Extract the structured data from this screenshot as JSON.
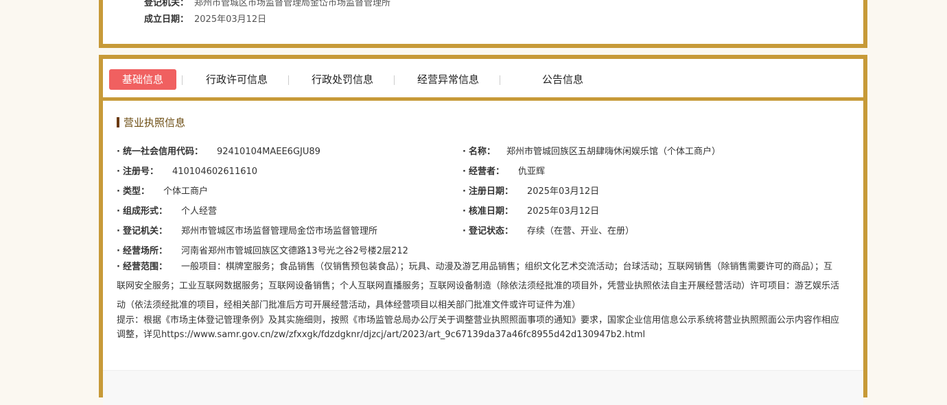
{
  "top": {
    "authority_label": "登记机关：",
    "authority_value": "郑州市管城区市场监督管理局金岱市场监督管理所",
    "date_label": "成立日期：",
    "date_value": "2025年03月12日"
  },
  "tabs": [
    {
      "label": "基础信息",
      "active": true
    },
    {
      "label": "行政许可信息"
    },
    {
      "label": "行政处罚信息"
    },
    {
      "label": "经营异常信息"
    },
    {
      "label": "公告信息"
    }
  ],
  "section": {
    "title": "营业执照信息"
  },
  "fields": {
    "credit_code": {
      "label": "统一社会信用代码：",
      "value": "92410104MAEE6GJU89"
    },
    "name": {
      "label": "名称：",
      "value": "郑州市管城回族区五胡肆嗨休闲娱乐馆（个体工商户）"
    },
    "reg_no": {
      "label": "注册号：",
      "value": "410104602611610"
    },
    "operator": {
      "label": "经营者：",
      "value": "仇亚辉"
    },
    "type": {
      "label": "类型：",
      "value": "个体工商户"
    },
    "reg_date": {
      "label": "注册日期：",
      "value": "2025年03月12日"
    },
    "form": {
      "label": "组成形式：",
      "value": "个人经营"
    },
    "approve_date": {
      "label": "核准日期：",
      "value": "2025年03月12日"
    },
    "authority": {
      "label": "登记机关：",
      "value": "郑州市管城区市场监督管理局金岱市场监督管理所"
    },
    "status": {
      "label": "登记状态：",
      "value": "存续（在营、开业、在册）"
    },
    "address": {
      "label": "经营场所：",
      "value": "河南省郑州市管城回族区文德路13号光之谷2号楼2层212"
    }
  },
  "scope": {
    "label": "经营范围：",
    "value": "一般项目：棋牌室服务；食品销售（仅销售预包装食品）；玩具、动漫及游艺用品销售；组织文化艺术交流活动；台球活动；互联网销售（除销售需要许可的商品）；互联网安全服务；工业互联网数据服务；互联网设备销售；个人互联网直播服务；互联网设备制造（除依法须经批准的项目外，凭营业执照依法自主开展经营活动）许可项目：游艺娱乐活动（依法须经批准的项目，经相关部门批准后方可开展经营活动，具体经营项目以相关部门批准文件或许可证件为准）"
  },
  "tip": "提示：根据《市场主体登记管理条例》及其实施细则，按照《市场监管总局办公厅关于调整营业执照照面事项的通知》要求，国家企业信用信息公示系统将营业执照照面公示内容作相应调整，详见https://www.samr.gov.cn/zw/zfxxgk/fdzdgknr/djzcj/art/2023/art_9c67139da37a46fc8955d42d130947b2.html",
  "colors": {
    "accent": "#c79a38",
    "active_tab": "#f06060",
    "section_title": "#6b4b10"
  }
}
